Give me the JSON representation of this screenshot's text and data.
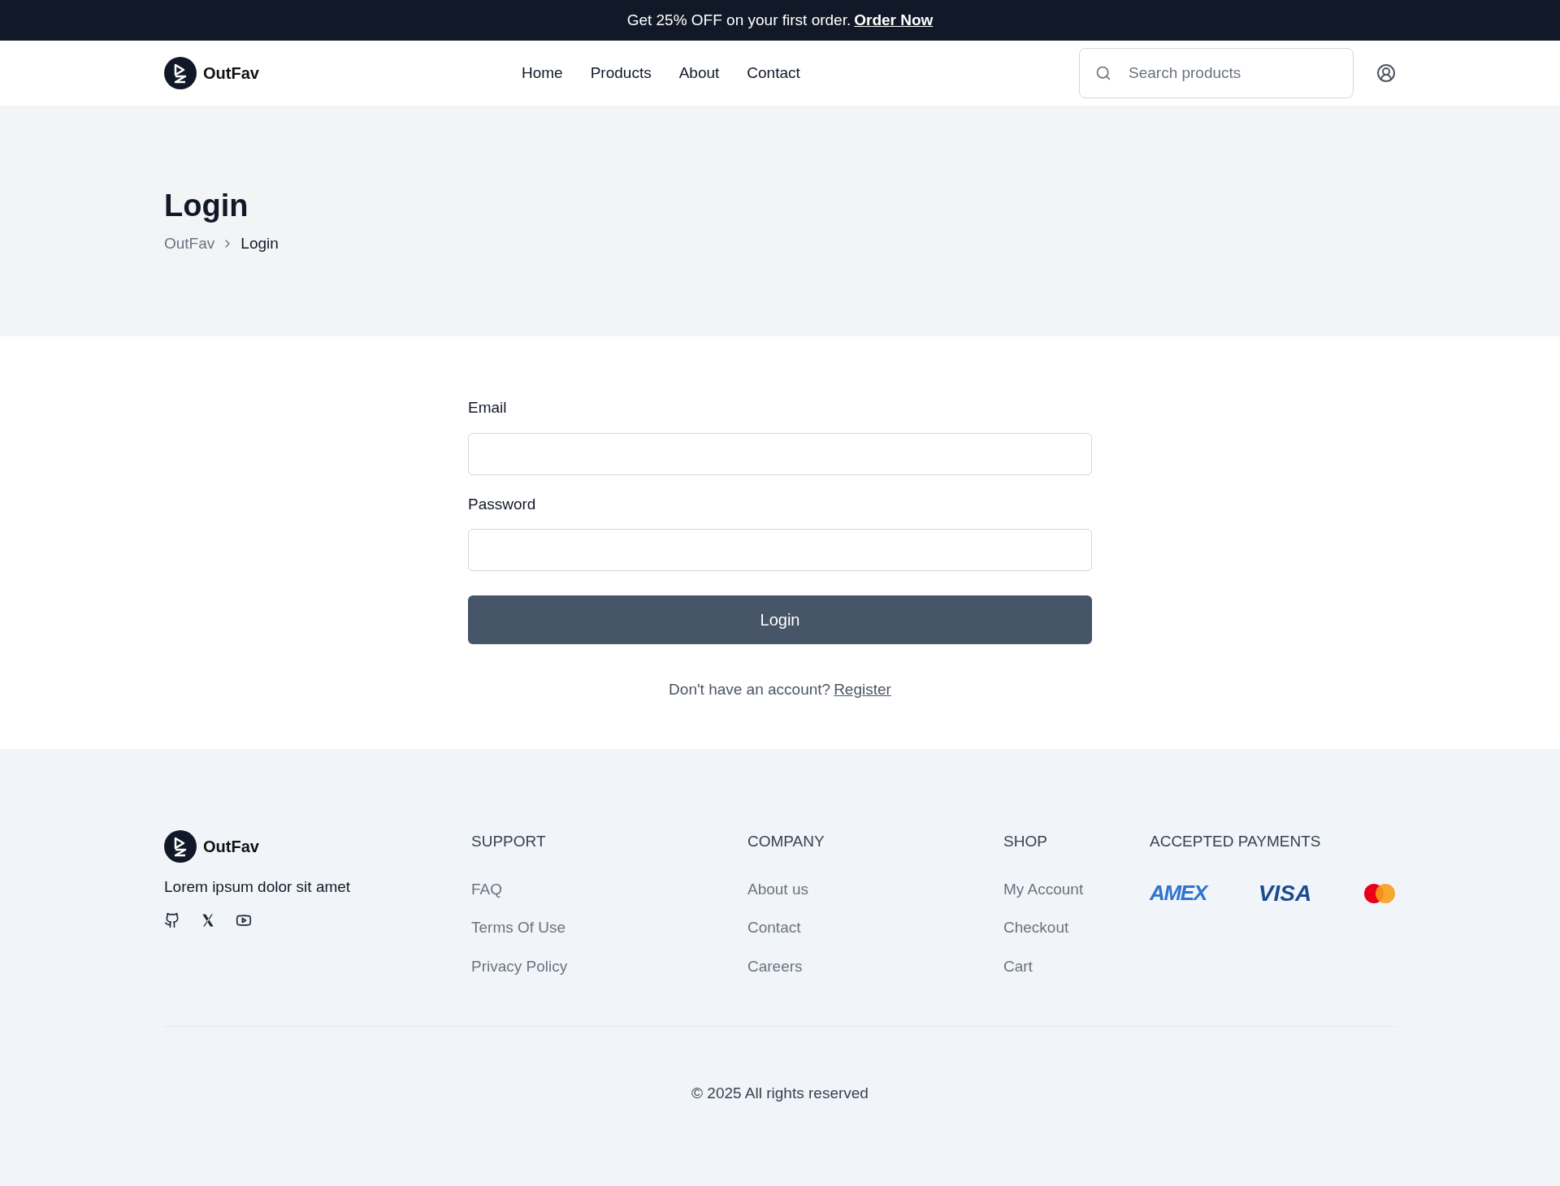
{
  "banner": {
    "text": "Get 25% OFF on your first order.",
    "link": "Order Now"
  },
  "header": {
    "brand": "OutFav",
    "nav": [
      {
        "label": "Home"
      },
      {
        "label": "Products"
      },
      {
        "label": "About"
      },
      {
        "label": "Contact"
      }
    ],
    "search": {
      "placeholder": "Search products"
    }
  },
  "hero": {
    "title": "Login",
    "breadcrumb": [
      {
        "label": "OutFav",
        "current": false
      },
      {
        "label": "Login",
        "current": true
      }
    ]
  },
  "form": {
    "fields": [
      {
        "label": "Email"
      },
      {
        "label": "Password"
      }
    ],
    "submit": "Login",
    "prompt": "Don't have an account?",
    "link": "Register"
  },
  "footer": {
    "brand": "OutFav",
    "tagline": "Lorem ipsum dolor sit amet",
    "socials": [
      {
        "kind": "github"
      },
      {
        "kind": "x"
      },
      {
        "kind": "youtube"
      }
    ],
    "columns": [
      {
        "title": "SUPPORT",
        "links": [
          "FAQ",
          "Terms Of Use",
          "Privacy Policy"
        ]
      },
      {
        "title": "COMPANY",
        "links": [
          "About us",
          "Contact",
          "Careers"
        ]
      },
      {
        "title": "SHOP",
        "links": [
          "My Account",
          "Checkout",
          "Cart"
        ]
      }
    ],
    "payments": {
      "title": "ACCEPTED PAYMENTS",
      "items": [
        {
          "kind": "amex",
          "label": "AMEX"
        },
        {
          "kind": "visa",
          "label": "VISA"
        },
        {
          "kind": "mastercard"
        }
      ]
    },
    "copyright": "© 2025 All rights reserved"
  }
}
